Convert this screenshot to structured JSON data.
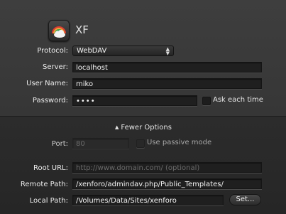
{
  "header": {
    "site_name": "XF"
  },
  "form": {
    "protocol": {
      "label": "Protocol:",
      "value": "WebDAV"
    },
    "server": {
      "label": "Server:",
      "value": "localhost"
    },
    "username": {
      "label": "User Name:",
      "value": "miko"
    },
    "password": {
      "label": "Password:",
      "value": "••••",
      "ask_label": "Ask each time"
    }
  },
  "options": {
    "toggle_label": "Fewer Options",
    "port": {
      "label": "Port:",
      "placeholder": "80",
      "passive_label": "Use passive mode"
    },
    "root_url": {
      "label": "Root URL:",
      "placeholder": "http://www.domain.com/ (optional)"
    },
    "remote_path": {
      "label": "Remote Path:",
      "value": "/xenforo/admindav.php/Public_Templates/"
    },
    "local_path": {
      "label": "Local Path:",
      "value": "/Volumes/Data/Sites/xenforo",
      "set_label": "Set..."
    }
  }
}
